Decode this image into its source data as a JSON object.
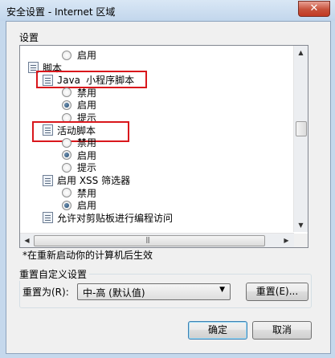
{
  "window": {
    "title": "安全设置 - Internet 区域",
    "close_glyph": "✕"
  },
  "settings": {
    "group_label": "设置",
    "rows": [
      {
        "kind": "radio",
        "label": "启用",
        "checked": false
      },
      {
        "kind": "category",
        "label": "脚本"
      },
      {
        "kind": "category",
        "label": "Java 小程序脚本",
        "mono": true,
        "highlighted": true
      },
      {
        "kind": "radio",
        "label": "禁用",
        "checked": false
      },
      {
        "kind": "radio",
        "label": "启用",
        "checked": true
      },
      {
        "kind": "radio",
        "label": "提示",
        "checked": false
      },
      {
        "kind": "category",
        "label": "活动脚本",
        "highlighted": true
      },
      {
        "kind": "radio",
        "label": "禁用",
        "checked": false
      },
      {
        "kind": "radio",
        "label": "启用",
        "checked": true
      },
      {
        "kind": "radio",
        "label": "提示",
        "checked": false
      },
      {
        "kind": "category",
        "label": "启用 XSS 筛选器"
      },
      {
        "kind": "radio",
        "label": "禁用",
        "checked": false
      },
      {
        "kind": "radio",
        "label": "启用",
        "checked": true
      },
      {
        "kind": "category",
        "label": "允许对剪贴板进行编程访问"
      }
    ],
    "note": "*在重新启动你的计算机后生效"
  },
  "reset": {
    "group_label": "重置自定义设置",
    "reset_to_label": "重置为(R):",
    "selected_level": "中-高 (默认值)",
    "reset_button": "重置(E)..."
  },
  "footer": {
    "ok": "确定",
    "cancel": "取消"
  }
}
